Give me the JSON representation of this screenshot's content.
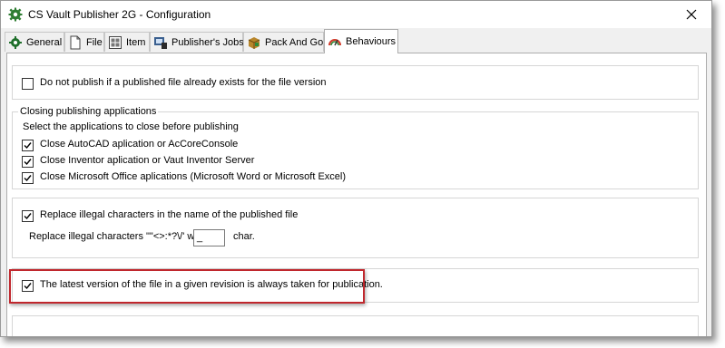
{
  "window": {
    "title": "CS Vault Publisher 2G - Configuration"
  },
  "tabs": [
    {
      "label": "General",
      "icon": "gear-icon"
    },
    {
      "label": "File",
      "icon": "file-icon"
    },
    {
      "label": "Item",
      "icon": "item-grid-icon"
    },
    {
      "label": "Publisher's Jobs",
      "icon": "jobs-icon"
    },
    {
      "label": "Pack And Go",
      "icon": "package-icon"
    },
    {
      "label": "Behaviours",
      "icon": "behaviours-icon",
      "active": true
    }
  ],
  "behaviours": {
    "no_publish_existing": {
      "label": "Do not publish if a published file already exists for the file version",
      "checked": false
    },
    "closing": {
      "legend": "Closing publishing applications",
      "instruction": "Select the applications to close before publishing",
      "items": [
        {
          "label": "Close AutoCAD aplication or AcCoreConsole",
          "checked": true
        },
        {
          "label": "Close Inventor aplication or Vaut Inventor Server",
          "checked": true
        },
        {
          "label": "Close Microsoft Office aplications (Microsoft Word or Microsoft Excel)",
          "checked": true
        }
      ]
    },
    "illegal": {
      "label": "Replace illegal characters in the name of the published file",
      "checked": true,
      "replace_text": "Replace illegal characters \"\"<>:*?\\/' with",
      "replace_value": "_",
      "suffix": "char."
    },
    "latest_version": {
      "label": "The latest version of the file in a given revision is always taken for publication.",
      "checked": true
    }
  },
  "colors": {
    "highlight": "#c0272d",
    "window_bg": "#f0f0f0"
  }
}
